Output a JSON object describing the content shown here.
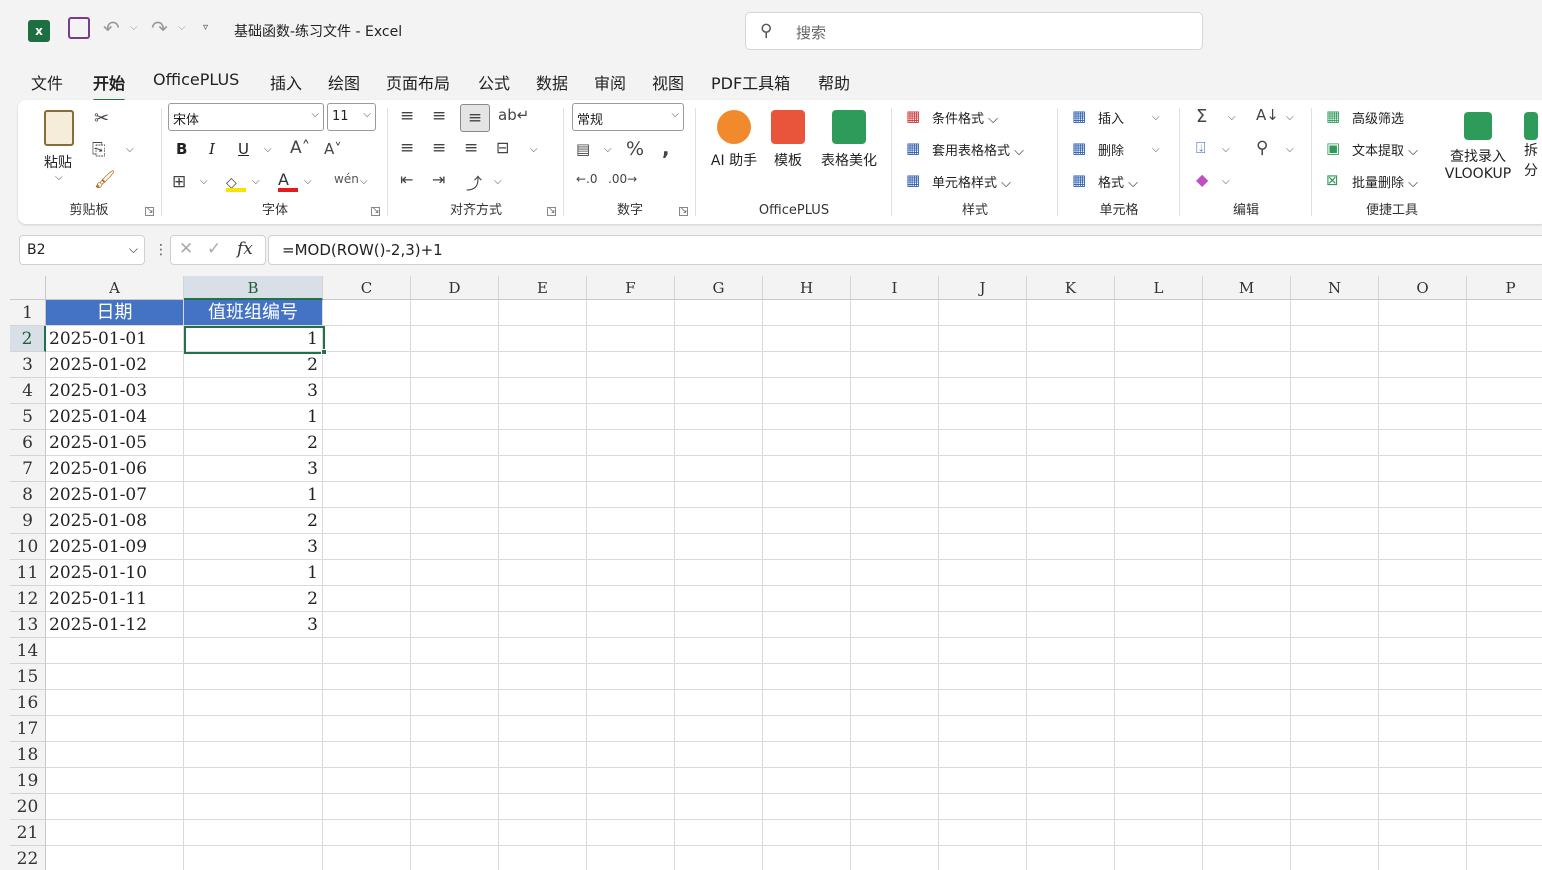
{
  "app": {
    "title": "基础函数-练习文件  -  Excel",
    "search_placeholder": "搜索"
  },
  "menu": [
    "文件",
    "开始",
    "OfficePLUS",
    "插入",
    "绘图",
    "页面布局",
    "公式",
    "数据",
    "审阅",
    "视图",
    "PDF工具箱",
    "帮助"
  ],
  "ribbon": {
    "clipboard": {
      "label": "剪贴板",
      "paste": "粘贴"
    },
    "font": {
      "label": "字体",
      "font_name": "宋体",
      "font_size": "11",
      "bold": "B",
      "italic": "I",
      "underline": "U"
    },
    "alignment": {
      "label": "对齐方式"
    },
    "number": {
      "label": "数字",
      "format": "常规"
    },
    "officeplus": {
      "label": "OfficePLUS",
      "ai": "AI 助手",
      "template": "模板",
      "beautify": "表格美化"
    },
    "styles": {
      "label": "样式",
      "conditional": "条件格式",
      "table_format": "套用表格格式",
      "cell_styles": "单元格样式"
    },
    "cells": {
      "label": "单元格",
      "insert": "插入",
      "delete": "删除",
      "format": "格式"
    },
    "editing": {
      "label": "编辑"
    },
    "tools": {
      "label": "便捷工具",
      "advanced_filter": "高级筛选",
      "text_extract": "文本提取",
      "batch_delete": "批量删除",
      "vlookup_line1": "查找录入",
      "vlookup_line2": "VLOOKUP",
      "split_partial": "拆分"
    }
  },
  "formula_bar": {
    "name_box": "B2",
    "fx": "fx",
    "formula": "=MOD(ROW()-2,3)+1"
  },
  "sheet": {
    "columns": [
      "A",
      "B",
      "C",
      "D",
      "E",
      "F",
      "G",
      "H",
      "I",
      "J",
      "K",
      "L",
      "M",
      "N",
      "O",
      "P"
    ],
    "rows": [
      "1",
      "2",
      "3",
      "4",
      "5",
      "6",
      "7",
      "8",
      "9",
      "10",
      "11",
      "12",
      "13",
      "14",
      "15",
      "16",
      "17",
      "18",
      "19",
      "20",
      "21",
      "22"
    ],
    "headers": [
      "日期",
      "值班组编号"
    ],
    "data": [
      [
        "2025-01-01",
        "1"
      ],
      [
        "2025-01-02",
        "2"
      ],
      [
        "2025-01-03",
        "3"
      ],
      [
        "2025-01-04",
        "1"
      ],
      [
        "2025-01-05",
        "2"
      ],
      [
        "2025-01-06",
        "3"
      ],
      [
        "2025-01-07",
        "1"
      ],
      [
        "2025-01-08",
        "2"
      ],
      [
        "2025-01-09",
        "3"
      ],
      [
        "2025-01-10",
        "1"
      ],
      [
        "2025-01-11",
        "2"
      ],
      [
        "2025-01-12",
        "3"
      ]
    ],
    "selected_cell": "B2"
  },
  "colors": {
    "accent": "#217346",
    "header_fill": "#4472c4"
  }
}
